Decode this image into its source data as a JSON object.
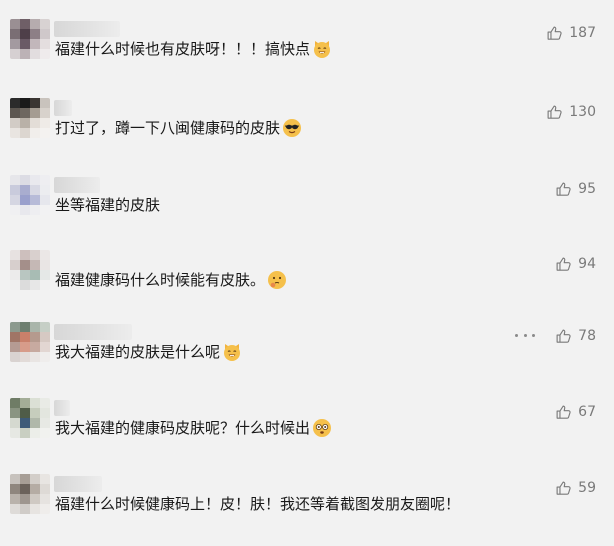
{
  "comments": [
    {
      "text": "福建什么时候也有皮肤呀！！！搞快点",
      "likes": "187",
      "emoji_icon": "cat-smile-icon",
      "avatar": [
        "#9a8f93",
        "#6f5f67",
        "#b6acae",
        "#d8d2d2",
        "#7a6e74",
        "#4e3f49",
        "#8d7f86",
        "#cfc8ca",
        "#a39aa0",
        "#6a5a66",
        "#c2b7bb",
        "#e4dedf",
        "#d6d0d2",
        "#bcb2b6",
        "#e2dddf",
        "#efebec"
      ]
    },
    {
      "text": "打过了，蹲一下八闽健康码的皮肤",
      "likes": "130",
      "emoji_icon": "sunglasses-icon",
      "avatar": [
        "#2b2b2b",
        "#1a1a1a",
        "#3a3532",
        "#c9c3bd",
        "#5c5650",
        "#6e6760",
        "#a59c92",
        "#d8d2cc",
        "#d2ccc6",
        "#b9b1a8",
        "#e3ddd7",
        "#efebe7",
        "#e9e5e1",
        "#dcd6d0",
        "#f1eeeb",
        "#f4f2f0"
      ]
    },
    {
      "text": "坐等福建的皮肤",
      "likes": "95",
      "emoji_icon": "",
      "avatar": [
        "#e6e6ea",
        "#dcdce4",
        "#e9e9ee",
        "#eeeef1",
        "#c9cbdc",
        "#a9adcf",
        "#d8d9e4",
        "#ecedf0",
        "#d5d6e2",
        "#9aa0cc",
        "#b7bbd8",
        "#e6e7ed",
        "#f0f0f2",
        "#e8e8ed",
        "#eeeef1",
        "#f2f2f3"
      ]
    },
    {
      "text": "福建健康码什么时候能有皮肤。",
      "likes": "94",
      "emoji_icon": "thinking-face-icon",
      "avatar": [
        "#e7e2e1",
        "#cdbfbd",
        "#d9d0ce",
        "#ebe7e6",
        "#d7cfcd",
        "#a48f8a",
        "#c5b8b5",
        "#e9e5e4",
        "#ecebeb",
        "#b9c6c1",
        "#a8bcb4",
        "#e5e8e7",
        "#f0f0f0",
        "#dcdcdc",
        "#e7e7e7",
        "#f1f1f1"
      ]
    },
    {
      "text": "我大福建的皮肤是什么呢",
      "likes": "78",
      "emoji_icon": "cat-smile-icon",
      "avatar": [
        "#8c9a8e",
        "#6e7f70",
        "#a9b5aa",
        "#c6cfc6",
        "#a07566",
        "#c9806a",
        "#b59a8e",
        "#d6c9c3",
        "#b59b93",
        "#d79c8a",
        "#c7aaa0",
        "#e2d6d2",
        "#d9d3d1",
        "#e2dbd8",
        "#e9e5e3",
        "#efedec"
      ]
    },
    {
      "text": "我大福建的健康码皮肤呢？什么时候出",
      "likes": "67",
      "emoji_icon": "dizzy-face-icon",
      "avatar": [
        "#6f7c66",
        "#a3ad97",
        "#dbe0d5",
        "#e9ebe6",
        "#8a9482",
        "#4f5c48",
        "#c6cdbd",
        "#e3e6df",
        "#d5d9d0",
        "#3e5b78",
        "#b0b8aa",
        "#e7e9e4",
        "#e6e8e3",
        "#c9cfc2",
        "#eceee9",
        "#f1f2ef"
      ]
    },
    {
      "text": "福建什么时候健康码上！皮！肤！我还等着截图发朋友圈呢！",
      "likes": "59",
      "emoji_icon": "",
      "avatar": [
        "#c7c2bd",
        "#a79e96",
        "#d3cec9",
        "#e8e5e2",
        "#8f867e",
        "#6b625b",
        "#b5aca4",
        "#dedad6",
        "#b9b2ab",
        "#9e968f",
        "#cfc9c3",
        "#e6e3e0",
        "#dedbd8",
        "#d0ccc8",
        "#e7e4e1",
        "#efedeb"
      ]
    }
  ]
}
